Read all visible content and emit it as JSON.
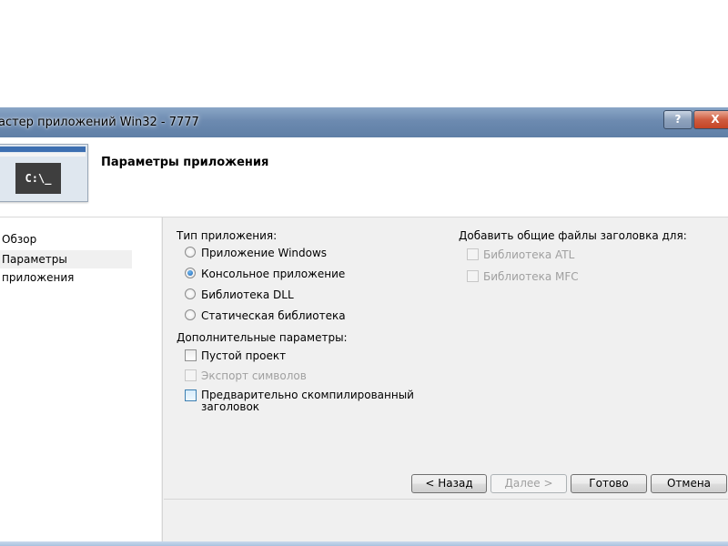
{
  "window": {
    "title": "астер приложений Win32 - 7777",
    "help_glyph": "?",
    "close_glyph": "X"
  },
  "header": {
    "title": "Параметры приложения",
    "thumbnail_text": "C:\\_"
  },
  "nav": {
    "items": [
      {
        "label": "Обзор",
        "selected": false
      },
      {
        "label": "Параметры приложения",
        "selected": true
      }
    ]
  },
  "app_type": {
    "label": "Тип приложения:",
    "options": [
      {
        "label": "Приложение Windows",
        "checked": false
      },
      {
        "label": "Консольное приложение",
        "checked": true
      },
      {
        "label": "Библиотека DLL",
        "checked": false
      },
      {
        "label": "Статическая библиотека",
        "checked": false
      }
    ]
  },
  "extra": {
    "label": "Дополнительные параметры:",
    "options": [
      {
        "label": "Пустой проект",
        "checked": false,
        "enabled": true
      },
      {
        "label": "Экспорт символов",
        "checked": false,
        "enabled": false
      },
      {
        "label": "Предварительно скомпилированный",
        "label2": "заголовок",
        "checked": false,
        "enabled": true
      }
    ]
  },
  "headers": {
    "label": "Добавить общие файлы заголовка для:",
    "options": [
      {
        "label": "Библиотека ATL",
        "checked": false,
        "enabled": false
      },
      {
        "label": "Библиотека MFC",
        "checked": false,
        "enabled": false
      }
    ]
  },
  "buttons": {
    "back": "< Назад",
    "next": "Далее >",
    "finish": "Готово",
    "cancel": "Отмена"
  }
}
